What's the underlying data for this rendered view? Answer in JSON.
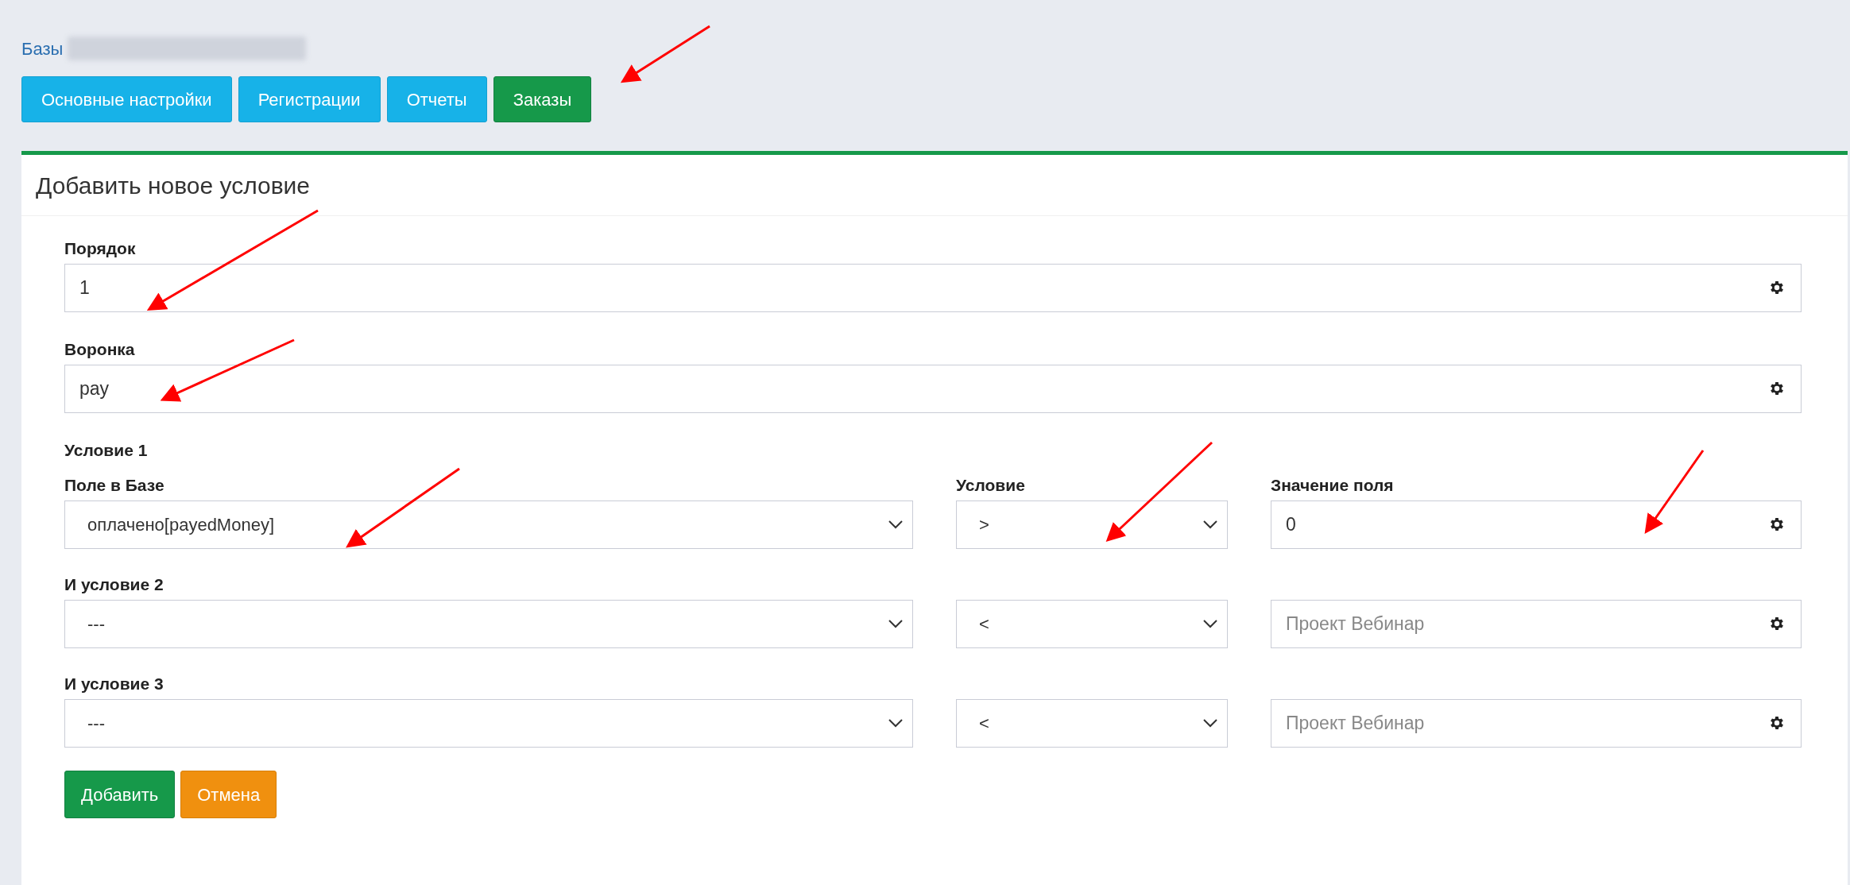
{
  "breadcrumb": {
    "link": "Базы"
  },
  "tabs": [
    {
      "label": "Основные настройки",
      "selected": false
    },
    {
      "label": "Регистрации",
      "selected": false
    },
    {
      "label": "Отчеты",
      "selected": false
    },
    {
      "label": "Заказы",
      "selected": true
    }
  ],
  "card": {
    "title": "Добавить новое условие",
    "order": {
      "label": "Порядок",
      "value": "1"
    },
    "funnel": {
      "label": "Воронка",
      "value": "pay"
    },
    "group_label": "Условие 1",
    "conditions": [
      {
        "label": "Поле в Базе",
        "field": "оплачено[payedMoney]",
        "operator_label": "Условие",
        "operator": ">",
        "value_label": "Значение поля",
        "value": "0"
      },
      {
        "label": "И условие 2",
        "field": "---",
        "operator": "<",
        "value_placeholder": "Проект Вебинар"
      },
      {
        "label": "И условие 3",
        "field": "---",
        "operator": "<",
        "value_placeholder": "Проект Вебинар"
      }
    ],
    "buttons": [
      {
        "label": "Добавить",
        "kind": "primary"
      },
      {
        "label": "Отмена",
        "kind": "cancel"
      }
    ]
  }
}
